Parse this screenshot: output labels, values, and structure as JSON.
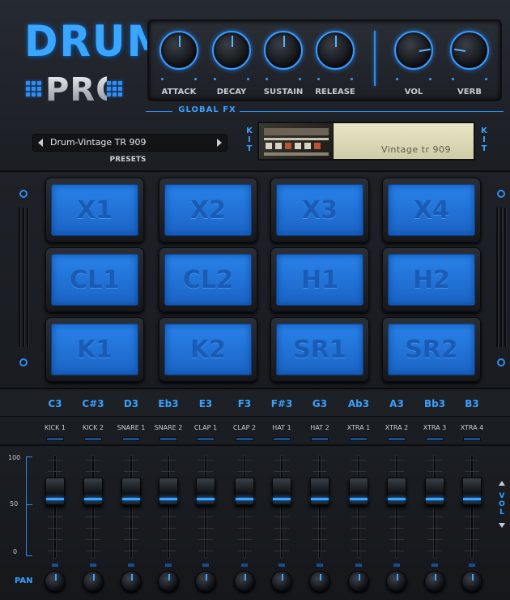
{
  "logo": {
    "top": "DRUM",
    "bottom": "PRO"
  },
  "fx": {
    "knobs": [
      {
        "label": "ATTACK",
        "value": 0.5
      },
      {
        "label": "DECAY",
        "value": 0.5
      },
      {
        "label": "SUSTAIN",
        "value": 0.5
      },
      {
        "label": "RELEASE",
        "value": 0.5
      },
      {
        "label": "VOL",
        "value": 0.8
      },
      {
        "label": "VERB",
        "value": 0.2
      }
    ],
    "section_label": "GLOBAL FX"
  },
  "presets": {
    "current": "Drum-Vintage TR 909",
    "label": "PRESETS"
  },
  "kit": {
    "label": "KIT",
    "name": "Vintage tr 909"
  },
  "pads": [
    "X1",
    "X2",
    "X3",
    "X4",
    "CL1",
    "CL2",
    "H1",
    "H2",
    "K1",
    "K2",
    "SR1",
    "SR2"
  ],
  "notes": [
    "C3",
    "C#3",
    "D3",
    "Eb3",
    "E3",
    "F3",
    "F#3",
    "G3",
    "Ab3",
    "A3",
    "Bb3",
    "B3"
  ],
  "channels": [
    "KICK 1",
    "KICK 2",
    "SNARE 1",
    "SNARE 2",
    "CLAP 1",
    "CLAP 2",
    "HAT 1",
    "HAT 2",
    "XTRA 1",
    "XTRA 2",
    "XTRA 3",
    "XTRA 4"
  ],
  "faders": {
    "scale": [
      "100",
      "50",
      "0"
    ],
    "levels": [
      0.72,
      0.72,
      0.72,
      0.72,
      0.72,
      0.72,
      0.72,
      0.72,
      0.72,
      0.72,
      0.72,
      0.72
    ],
    "side_label": "VOL"
  },
  "pan": {
    "label": "PAN"
  },
  "colors": {
    "accent": "#2d8cf0",
    "pad": "#2a83ea",
    "background": "#1a1d22"
  }
}
